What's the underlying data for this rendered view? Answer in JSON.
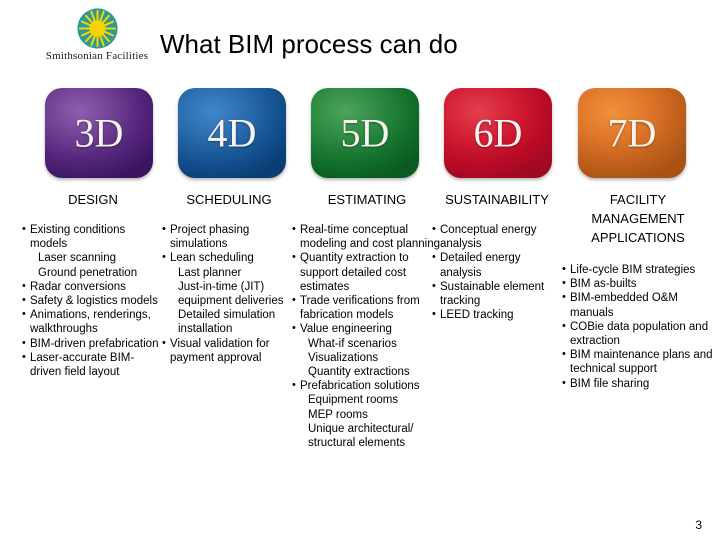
{
  "logo": {
    "caption": "Smithsonian Facilities",
    "icon": "sun-icon",
    "disc_color": "#2c9a9a",
    "sun_color": "#f5d400"
  },
  "title": "What BIM process can do",
  "slide_number": "3",
  "dboxes": [
    {
      "label": "3D",
      "color": "#6f3f92"
    },
    {
      "label": "4D",
      "color": "#2a6cad"
    },
    {
      "label": "5D",
      "color": "#2c8a42"
    },
    {
      "label": "6D",
      "color": "#d41f35"
    },
    {
      "label": "7D",
      "color": "#e0772a"
    }
  ],
  "columns": [
    {
      "header": "DESIGN",
      "items": [
        {
          "text": "Existing conditions models",
          "level": 1
        },
        {
          "text": "Laser scanning",
          "level": 2
        },
        {
          "text": "Ground penetration",
          "level": 2
        },
        {
          "text": "Radar conversions",
          "level": 1
        },
        {
          "text": "Safety & logistics models",
          "level": 1
        },
        {
          "text": "Animations, renderings, walkthroughs",
          "level": 1
        },
        {
          "text": "BIM-driven prefabrication",
          "level": 1
        },
        {
          "text": "Laser-accurate BIM-driven field layout",
          "level": 1
        }
      ]
    },
    {
      "header": "SCHEDULING",
      "items": [
        {
          "text": "Project phasing simulations",
          "level": 1
        },
        {
          "text": "Lean scheduling",
          "level": 1
        },
        {
          "text": "Last planner",
          "level": 2
        },
        {
          "text": "Just-in-time (JIT) equipment deliveries",
          "level": 2
        },
        {
          "text": "Detailed simulation installation",
          "level": 2
        },
        {
          "text": "Visual validation for payment approval",
          "level": 1
        }
      ]
    },
    {
      "header": "ESTIMATING",
      "items": [
        {
          "text": "Real-time conceptual modeling and cost planning",
          "level": 1
        },
        {
          "text": "Quantity extraction to support detailed cost estimates",
          "level": 1
        },
        {
          "text": "Trade verifications from fabrication models",
          "level": 1
        },
        {
          "text": "Value engineering",
          "level": 1
        },
        {
          "text": "What-if scenarios",
          "level": 2
        },
        {
          "text": "Visualizations",
          "level": 2
        },
        {
          "text": "Quantity extractions",
          "level": 2
        },
        {
          "text": "Prefabrication solutions",
          "level": 1
        },
        {
          "text": "Equipment rooms",
          "level": 2
        },
        {
          "text": "MEP rooms",
          "level": 2
        },
        {
          "text": "Unique architectural/ structural elements",
          "level": 2
        }
      ]
    },
    {
      "header": "SUSTAINABILITY",
      "items": [
        {
          "text": "Conceptual energy analysis",
          "level": 1
        },
        {
          "text": "Detailed energy analysis",
          "level": 1
        },
        {
          "text": "Sustainable element tracking",
          "level": 1
        },
        {
          "text": "LEED tracking",
          "level": 1
        }
      ]
    },
    {
      "header": "FACILITY\nMANAGEMENT\nAPPLICATIONS",
      "items": [
        {
          "text": "Life-cycle BIM strategies",
          "level": 1
        },
        {
          "text": "BIM as-builts",
          "level": 1
        },
        {
          "text": "BIM-embedded O&M manuals",
          "level": 1
        },
        {
          "text": "COBie data population and extraction",
          "level": 1
        },
        {
          "text": "BIM maintenance plans and technical support",
          "level": 1
        },
        {
          "text": "BIM file sharing",
          "level": 1
        }
      ]
    }
  ]
}
